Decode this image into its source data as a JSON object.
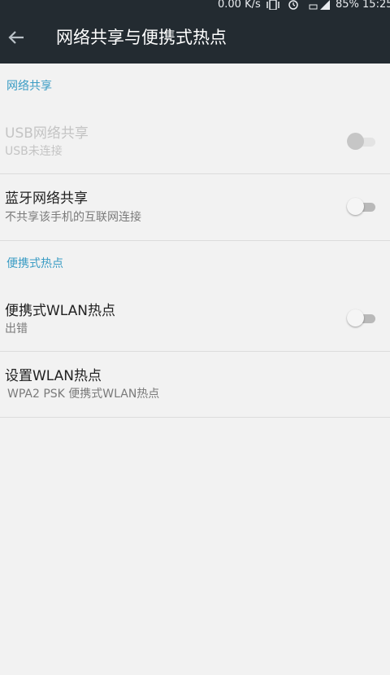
{
  "status_bar": {
    "net_speed": "0.00 K/s",
    "battery": "85% 15:25",
    "icons": [
      "vibrate-icon",
      "alarm-icon",
      "signal-icon"
    ]
  },
  "toolbar": {
    "back_icon": "arrow-left-icon",
    "title": "网络共享与便携式热点"
  },
  "sections": {
    "tethering": {
      "header": "网络共享",
      "usb": {
        "title": "USB网络共享",
        "summary": "USB未连接",
        "enabled": false,
        "checked": false
      },
      "bluetooth": {
        "title": "蓝牙网络共享",
        "summary": "不共享该手机的互联网连接",
        "enabled": true,
        "checked": false
      }
    },
    "hotspot": {
      "header": "便携式热点",
      "wlan_hotspot": {
        "title": "便携式WLAN热点",
        "summary": "出错",
        "enabled": true,
        "checked": false
      },
      "setup": {
        "title": "设置WLAN热点",
        "summary": "WPA2 PSK 便携式WLAN热点"
      }
    }
  },
  "colors": {
    "toolbar_bg": "#232b31",
    "accent": "#3a9cc4",
    "page_bg": "#f2f2f2"
  }
}
